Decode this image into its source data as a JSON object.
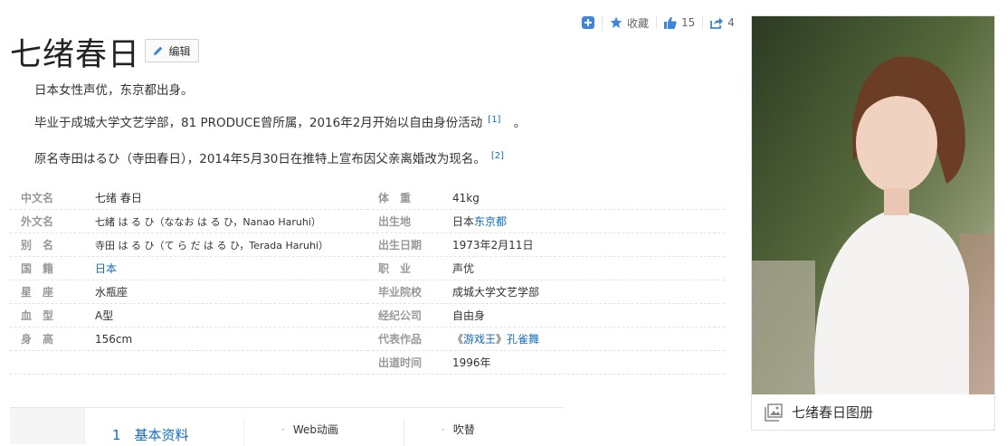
{
  "header": {
    "title": "七绪春日",
    "edit_label": "编辑",
    "favorite_label": "收藏",
    "like_count": "15",
    "share_count": "4",
    "icons": [
      "plus-icon",
      "star-icon",
      "thumbs-up-icon",
      "share-icon",
      "pencil-icon"
    ],
    "accent_color": "#3f86d8"
  },
  "summary": {
    "p1": "日本女性声优，东京都出身。",
    "p2": "毕业于成城大学文艺学部，81 PRODUCE曾所属，2016年2月开始以自由身份活动",
    "p2_ref": "[1]",
    "p2_end": "。",
    "p3": "原名寺田はるひ（寺田春日），2014年5月30日在推特上宣布因父亲离婚改为现名。",
    "p3_ref": "[2]"
  },
  "infobox": {
    "left": [
      {
        "label": "中文名",
        "value": "七绪 春日"
      },
      {
        "label": "外文名",
        "value": "七緒 は る ひ（ななお は る ひ，Nanao Haruhi）"
      },
      {
        "label": "别　名",
        "value": "寺田 は る ひ（て ら だ は る ひ，Terada Haruhi）"
      },
      {
        "label": "国　籍",
        "value": "日本"
      },
      {
        "label": "星　座",
        "value": "水瓶座"
      },
      {
        "label": "血　型",
        "value": "A型"
      },
      {
        "label": "身　高",
        "value": "156cm"
      }
    ],
    "right": [
      {
        "label": "体　重",
        "value": "41kg"
      },
      {
        "label": "出生地",
        "value_prefix": "日本",
        "value": "东京都"
      },
      {
        "label": "出生日期",
        "value": "1973年2月11日"
      },
      {
        "label": "职　业",
        "value": "声优"
      },
      {
        "label": "毕业院校",
        "value": "成城大学文艺学部"
      },
      {
        "label": "经纪公司",
        "value": "自由身"
      },
      {
        "label": "代表作品",
        "value_prefix": "《",
        "value": "游戏王",
        "value_mid": "》",
        "value2": "孔雀舞"
      },
      {
        "label": "出道时间",
        "value": "1996年"
      }
    ],
    "link_color": "#136ec2"
  },
  "toc": {
    "section": "1　基本资料",
    "sub1": "Web动画",
    "sub2": "吹替"
  },
  "album": {
    "label": "七绪春日图册"
  }
}
